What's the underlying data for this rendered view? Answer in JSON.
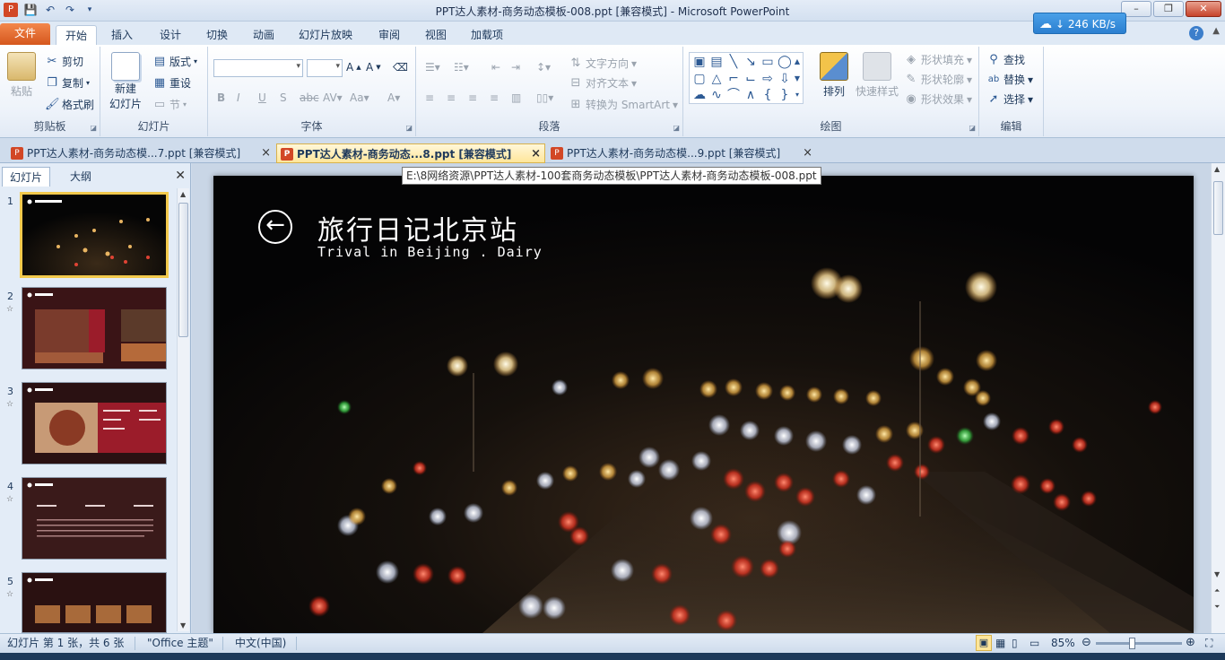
{
  "window": {
    "title": "PPT达人素材-商务动态模板-008.ppt [兼容模式]  -  Microsoft PowerPoint",
    "speed": "246 KB/s",
    "minimize": "–",
    "restore": "❐",
    "close": "✕"
  },
  "ribbon_tabs": [
    "文件",
    "开始",
    "插入",
    "设计",
    "切换",
    "动画",
    "幻灯片放映",
    "审阅",
    "视图",
    "加载项"
  ],
  "ribbon": {
    "clipboard": {
      "paste": "粘贴",
      "cut": "剪切",
      "copy": "复制",
      "format_painter": "格式刷",
      "label": "剪贴板"
    },
    "slides": {
      "new_slide_1": "新建",
      "new_slide_2": "幻灯片",
      "layout": "版式",
      "reset": "重设",
      "section": "节",
      "label": "幻灯片"
    },
    "font": {
      "label": "字体"
    },
    "paragraph": {
      "text_direction": "文字方向",
      "align_text": "对齐文本",
      "convert_smartart": "转换为 SmartArt",
      "label": "段落"
    },
    "drawing": {
      "arrange": "排列",
      "quick_styles": "快速样式",
      "shape_fill": "形状填充",
      "shape_outline": "形状轮廓",
      "shape_effects": "形状效果",
      "label": "绘图"
    },
    "editing": {
      "find": "查找",
      "replace": "替换",
      "select": "选择",
      "label": "编辑"
    }
  },
  "doc_tabs": [
    {
      "label": "PPT达人素材-商务动态模...7.ppt [兼容模式]"
    },
    {
      "label": "PPT达人素材-商务动态...8.ppt [兼容模式]"
    },
    {
      "label": "PPT达人素材-商务动态模...9.ppt [兼容模式]"
    }
  ],
  "tooltip": "E:\\8网络资源\\PPT达人素材-100套商务动态模板\\PPT达人素材-商务动态模板-008.ppt",
  "panel_tabs": {
    "slides": "幻灯片",
    "outline": "大纲"
  },
  "thumbnails": [
    "1",
    "2",
    "3",
    "4",
    "5"
  ],
  "slide": {
    "title": "旅行日记北京站",
    "subtitle": "Trival in Beijing . Dairy"
  },
  "status": {
    "slide_info": "幻灯片 第 1 张，共 6 张",
    "theme": "\"Office 主题\"",
    "language": "中文(中国)",
    "zoom": "85%"
  }
}
